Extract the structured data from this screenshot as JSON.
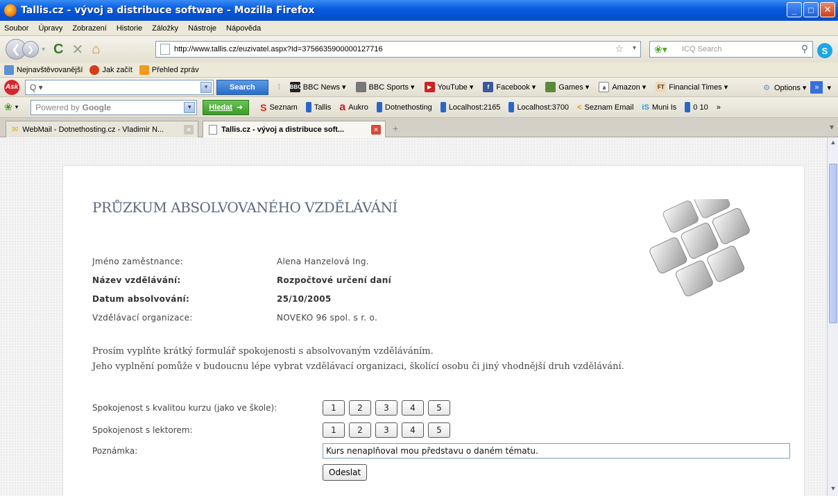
{
  "window": {
    "title": "Tallis.cz - vývoj a distribuce software - Mozilla Firefox"
  },
  "menu": [
    "Soubor",
    "Úpravy",
    "Zobrazení",
    "Historie",
    "Záložky",
    "Nástroje",
    "Nápověda"
  ],
  "nav": {
    "url": "http://www.tallis.cz/euzivatel.aspx?Id=3756635900000127716",
    "icq_placeholder": "ICQ Search"
  },
  "bookmarks": [
    "Nejnavštěvovanější",
    "Jak začít",
    "Přehled zpráv"
  ],
  "ask_toolbar": {
    "search_value": "Q ▾",
    "search_button": "Search",
    "items": [
      "BBC News ▾",
      "BBC Sports ▾",
      "YouTube ▾",
      "Facebook ▾",
      "Games ▾",
      "Amazon ▾",
      "Financial Times ▾"
    ],
    "options": "Options ▾"
  },
  "google_toolbar": {
    "placeholder_prefix": "Powered by",
    "brand": "Google",
    "button": "Hledat",
    "items": [
      "Seznam",
      "Tallis",
      "Aukro",
      "Dotnethosting",
      "Localhost:2165",
      "Localhost:3700",
      "Seznam Email",
      "Muni Is",
      "0 10"
    ]
  },
  "tabs": [
    {
      "label": "WebMail - Dotnethosting.cz - Vladimir N...",
      "active": false
    },
    {
      "label": "Tallis.cz - vývoj a distribuce soft...",
      "active": true
    }
  ],
  "page": {
    "heading": "PRŮZKUM ABSOLVOVANÉHO VZDĚLÁVÁNÍ",
    "fields": [
      {
        "label": "Jméno zaměstnance:",
        "value": "Alena Hanzelová Ing.",
        "bold": false
      },
      {
        "label": "Název vzdělávání:",
        "value": "Rozpočtové určení daní",
        "bold": true
      },
      {
        "label": "Datum absolvování:",
        "value": "25/10/2005",
        "bold": true
      },
      {
        "label": "Vzdělávací organizace:",
        "value": "NOVEKO 96 spol. s r. o.",
        "bold": false
      }
    ],
    "intro_line1": "Prosím vyplňte krátký formulář spokojenosti s absolvovaným vzděláváním.",
    "intro_line2": "Jeho vyplnění pomůže v budoucnu lépe vybrat vzdělávací organizaci, školící osobu či jiný vhodnější druh vzdělávání.",
    "rating_course_label": "Spokojenost s kvalitou kurzu (jako ve škole):",
    "rating_lector_label": "Spokojenost s lektorem:",
    "rating_values": [
      "1",
      "2",
      "3",
      "4",
      "5"
    ],
    "note_label": "Poznámka:",
    "note_value": "Kurs nenaplňoval mou představu o daném tématu.",
    "submit_label": "Odeslat"
  }
}
